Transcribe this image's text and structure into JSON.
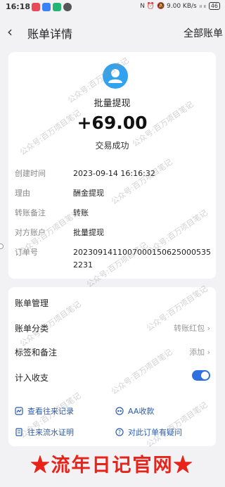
{
  "status_bar": {
    "time": "16:18",
    "right_text": "N ⏰ 🔕 9.00 KB/s",
    "signal": "ᵢₗ ᵢₗ",
    "battery": "46"
  },
  "nav": {
    "title": "账单详情",
    "right_link": "全部账单"
  },
  "transaction": {
    "name": "批量提现",
    "amount": "+69.00",
    "status": "交易成功"
  },
  "details": [
    {
      "key": "创建时间",
      "value": "2023-09-14 16:16:32"
    },
    {
      "key": "理由",
      "value": "酬金提现"
    },
    {
      "key": "转账备注",
      "value": "转账"
    },
    {
      "key": "对方账户",
      "value": "批量提现"
    },
    {
      "key": "订单号",
      "value": "20230914110070001506250005352231"
    }
  ],
  "management": {
    "title": "账单管理",
    "category_label": "账单分类",
    "category_value": "转账红包",
    "tags_label": "标签和备注",
    "tags_value": "添加",
    "include_label": "计入收支",
    "include_enabled": true
  },
  "links": {
    "history": "查看往来记录",
    "aa": "AA收款",
    "proof": "往来流水证明",
    "question": "对此订单有疑问"
  },
  "watermark": "公众号:百万项目笔记",
  "banner": "★流年日记官网★",
  "colors": {
    "accent": "#2f6fe0",
    "avatar": "#2fa3f0",
    "banner": "#e8231a"
  }
}
